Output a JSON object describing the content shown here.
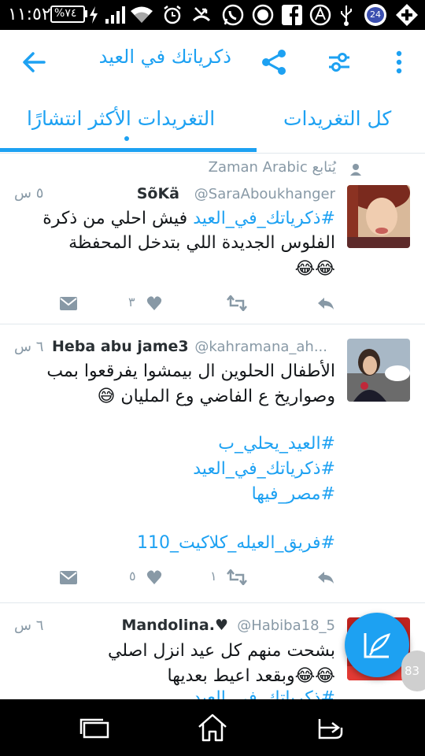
{
  "status_bar": {
    "time": "١١:٥٢",
    "battery": "%٧٤",
    "notification_count": "24",
    "icons": [
      "battery-icon",
      "charging-icon",
      "signal-icon",
      "wifi-icon",
      "alarm-icon",
      "missed-call-icon",
      "whatsapp-icon",
      "circle-app-icon",
      "facebook-icon",
      "avast-icon",
      "usb-icon",
      "badge-icon",
      "plus-app-icon"
    ]
  },
  "app_bar": {
    "search_query": "ذكرياتك في العيد",
    "icons": [
      "back-arrow-icon",
      "share-icon",
      "filter-icon",
      "overflow-menu-icon"
    ]
  },
  "tabs": {
    "all": "كل التغريدات",
    "top": "التغريدات الأكثر انتشارًا"
  },
  "feed": {
    "follow_context": "Zaman Arabic يُتابع",
    "tweets": [
      {
        "name": "SõKä",
        "handle": "@SaraAboukhanger",
        "time": "٥ س",
        "lines": [
          {
            "hashtag": "#ذكرياتك_في_العيد",
            "text": " فيش احلي من ذكرة"
          },
          {
            "text": "الفلوس الجديدة اللي بتدخل المحفظة"
          },
          {
            "text": "😂😂"
          }
        ],
        "likes": "٣",
        "retweets": ""
      },
      {
        "name": "Heba abu jame3",
        "handle": "@kahramana_ah...",
        "time": "٦ س",
        "lines": [
          {
            "text": "الأطفال الحلوين ال بيمشوا يفرقعوا بمب"
          },
          {
            "text": "وصواريخ ع الفاضي وع المليان 😅"
          },
          {
            "hashtag": "#العيد_يحلي_ب"
          },
          {
            "hashtag": "#ذكرياتك_في_العيد"
          },
          {
            "hashtag": "#مصر_فيها"
          },
          {
            "hashtag": "#فريق_العيله_كلاكيت_110"
          }
        ],
        "likes": "٥",
        "retweets": "١"
      },
      {
        "name": "Mandolina.♥",
        "handle": "@Habiba18_5",
        "time": "٦ س",
        "lines": [
          {
            "text": "بشحت منهم كل عيد انزل اصلي"
          },
          {
            "text": "😂😂وبقعد اعيط بعديها"
          },
          {
            "hashtag": "#ذكرياتك_في_العيد"
          }
        ]
      }
    ]
  },
  "side_bubble": "83",
  "colors": {
    "accent": "#1da1f2",
    "text": "#14171a",
    "muted": "#8899a6"
  }
}
